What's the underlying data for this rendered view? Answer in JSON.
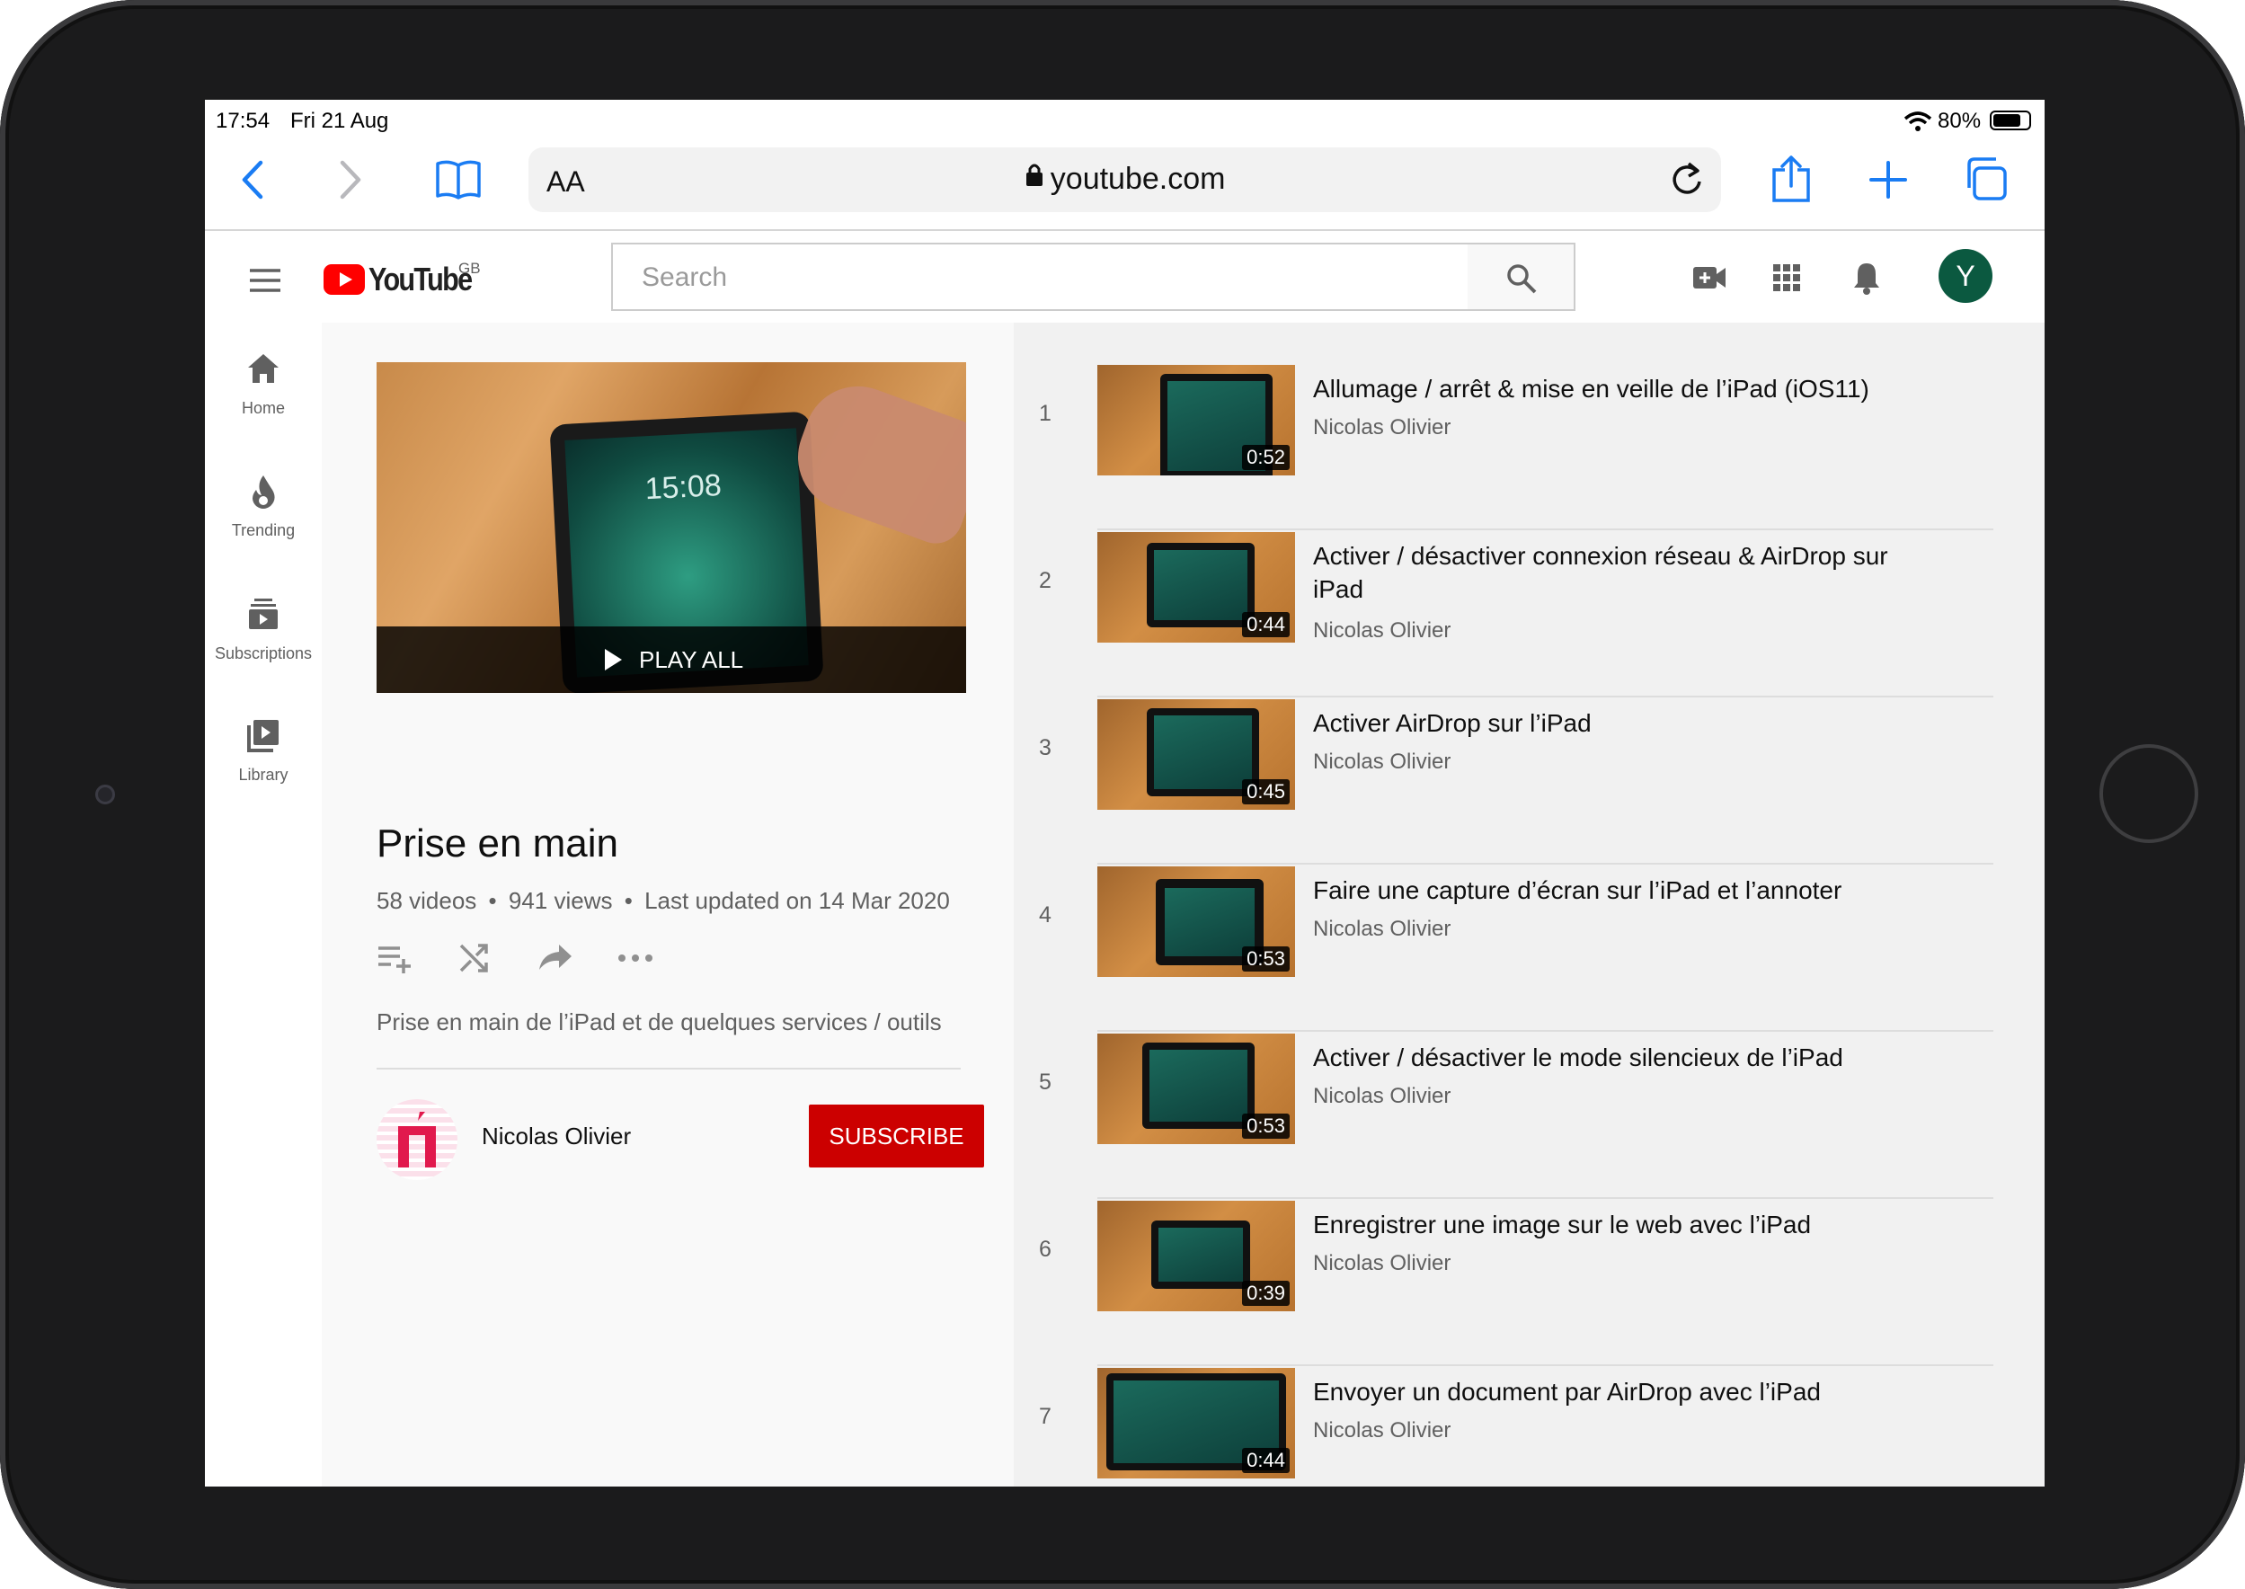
{
  "status_bar": {
    "time": "17:54",
    "date": "Fri 21 Aug",
    "battery": "80%"
  },
  "browser": {
    "text_size_label": "AA",
    "url": "youtube.com"
  },
  "youtube": {
    "logo_text": "YouTube",
    "region": "GB",
    "search_placeholder": "Search",
    "avatar_letter": "Y",
    "colors": {
      "brand_red": "#cc0000",
      "avatar_green": "#0b5940"
    }
  },
  "sidebar": {
    "items": [
      {
        "label": "Home",
        "icon": "home-icon"
      },
      {
        "label": "Trending",
        "icon": "fire-icon"
      },
      {
        "label": "Subscriptions",
        "icon": "subscriptions-icon"
      },
      {
        "label": "Library",
        "icon": "library-icon"
      }
    ]
  },
  "playlist": {
    "play_all": "PLAY ALL",
    "thumb_time": "15:08",
    "title": "Prise en main",
    "video_count": "58 videos",
    "views": "941 views",
    "updated": "Last updated on 14 Mar 2020",
    "description": "Prise en main de l’iPad et de quelques services / outils",
    "channel": "Nicolas Olivier",
    "subscribe_label": "SUBSCRIBE"
  },
  "videos": [
    {
      "index": "1",
      "title": "Allumage / arrêt & mise en veille de l’iPad (iOS11)",
      "channel": "Nicolas Olivier",
      "duration": "0:52"
    },
    {
      "index": "2",
      "title": "Activer / désactiver connexion réseau & AirDrop sur iPad",
      "channel": "Nicolas Olivier",
      "duration": "0:44"
    },
    {
      "index": "3",
      "title": "Activer AirDrop sur l’iPad",
      "channel": "Nicolas Olivier",
      "duration": "0:45"
    },
    {
      "index": "4",
      "title": "Faire une capture d’écran sur l’iPad et l’annoter",
      "channel": "Nicolas Olivier",
      "duration": "0:53"
    },
    {
      "index": "5",
      "title": "Activer / désactiver le mode silencieux de l’iPad",
      "channel": "Nicolas Olivier",
      "duration": "0:53"
    },
    {
      "index": "6",
      "title": "Enregistrer une image sur le web avec l’iPad",
      "channel": "Nicolas Olivier",
      "duration": "0:39"
    },
    {
      "index": "7",
      "title": "Envoyer un document par AirDrop avec l’iPad",
      "channel": "Nicolas Olivier",
      "duration": "0:44"
    }
  ]
}
